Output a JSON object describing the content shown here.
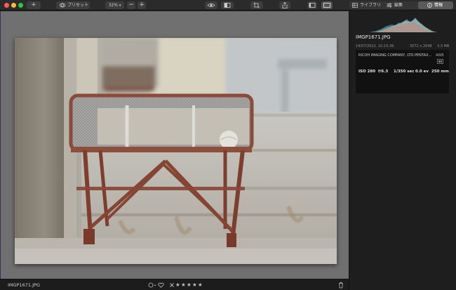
{
  "toolbar": {
    "add_label": "+",
    "preset_label": "プリセット",
    "zoom_label": "32%",
    "zoom_out_label": "−",
    "zoom_in_label": "+"
  },
  "right_tabs": [
    {
      "label": "ライブラリ"
    },
    {
      "label": "編集"
    },
    {
      "label": "情報"
    }
  ],
  "photo": {
    "description_icon": "photo-image"
  },
  "status": {
    "filename": "IMGP1671.JPG",
    "rating": 0,
    "max_stars": 5
  },
  "info": {
    "filename": "IMGP1671.JPG",
    "datetime": "14/07/2021, 10:15:36",
    "resolution": "3072 x 2048",
    "filesize": "3.3 MB",
    "camera_make": "RICOH IMAGING COMPANY, LTD.",
    "camera_model": "PENTAX...",
    "white_balance": "AWB",
    "iso": "ISO 280",
    "aperture": "f/6.3",
    "shutter": "1/350 sec",
    "exposure": "0.0 ev",
    "focal_length": "250 mm"
  },
  "colors": {
    "accent_purple": "#3a2c5c",
    "active_tab": "#5a5a5a",
    "canvas_bg": "#707070"
  }
}
